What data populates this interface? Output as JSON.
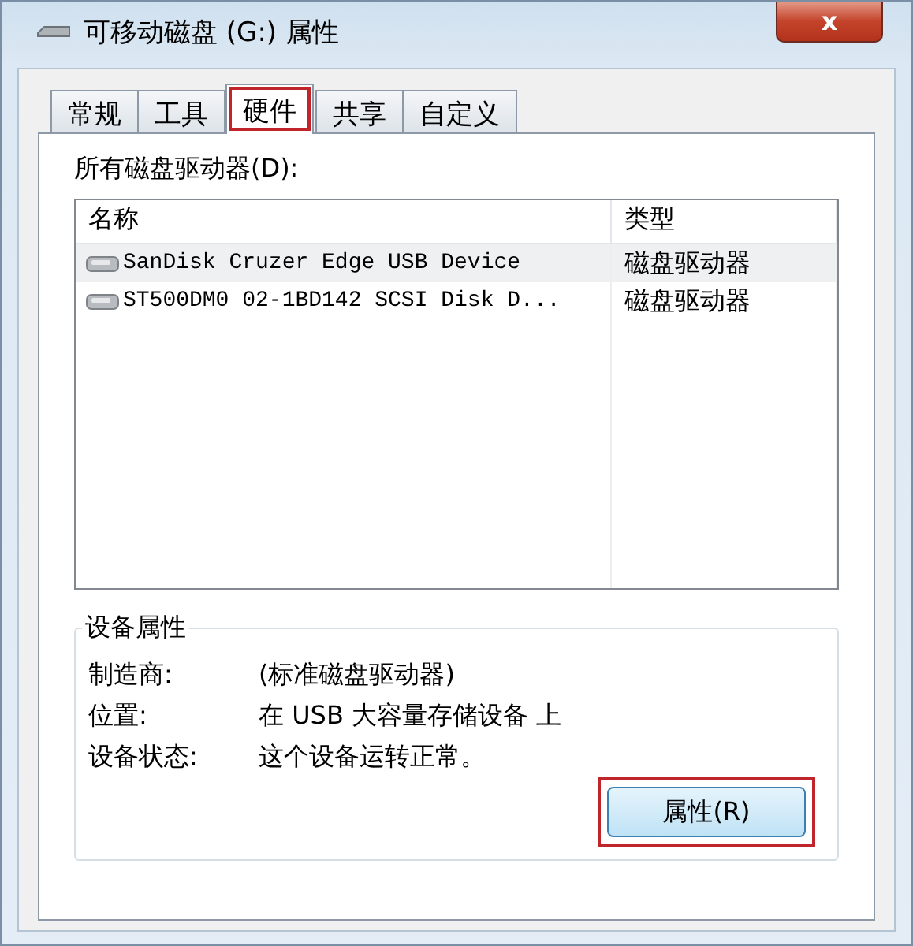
{
  "window": {
    "title": "可移动磁盘 (G:) 属性",
    "close": "x"
  },
  "tabs": [
    {
      "label": "常规",
      "selected": false,
      "highlighted": false
    },
    {
      "label": "工具",
      "selected": false,
      "highlighted": false
    },
    {
      "label": "硬件",
      "selected": true,
      "highlighted": true
    },
    {
      "label": "共享",
      "selected": false,
      "highlighted": false
    },
    {
      "label": "自定义",
      "selected": false,
      "highlighted": false
    }
  ],
  "drives": {
    "label": "所有磁盘驱动器(D):",
    "columns": [
      "名称",
      "类型"
    ],
    "rows": [
      {
        "name": "SanDisk Cruzer Edge USB Device",
        "type": "磁盘驱动器",
        "selected": true
      },
      {
        "name": "ST500DM0 02-1BD142 SCSI Disk D...",
        "type": "磁盘驱动器",
        "selected": false
      }
    ]
  },
  "device_properties": {
    "title": "设备属性",
    "fields": [
      {
        "label": "制造商:",
        "value": "(标准磁盘驱动器)"
      },
      {
        "label": "位置:",
        "value": "在 USB 大容量存储设备 上"
      },
      {
        "label": "设备状态:",
        "value": "这个设备运转正常。"
      }
    ],
    "button": {
      "label": "属性(R)",
      "highlighted": true
    }
  }
}
